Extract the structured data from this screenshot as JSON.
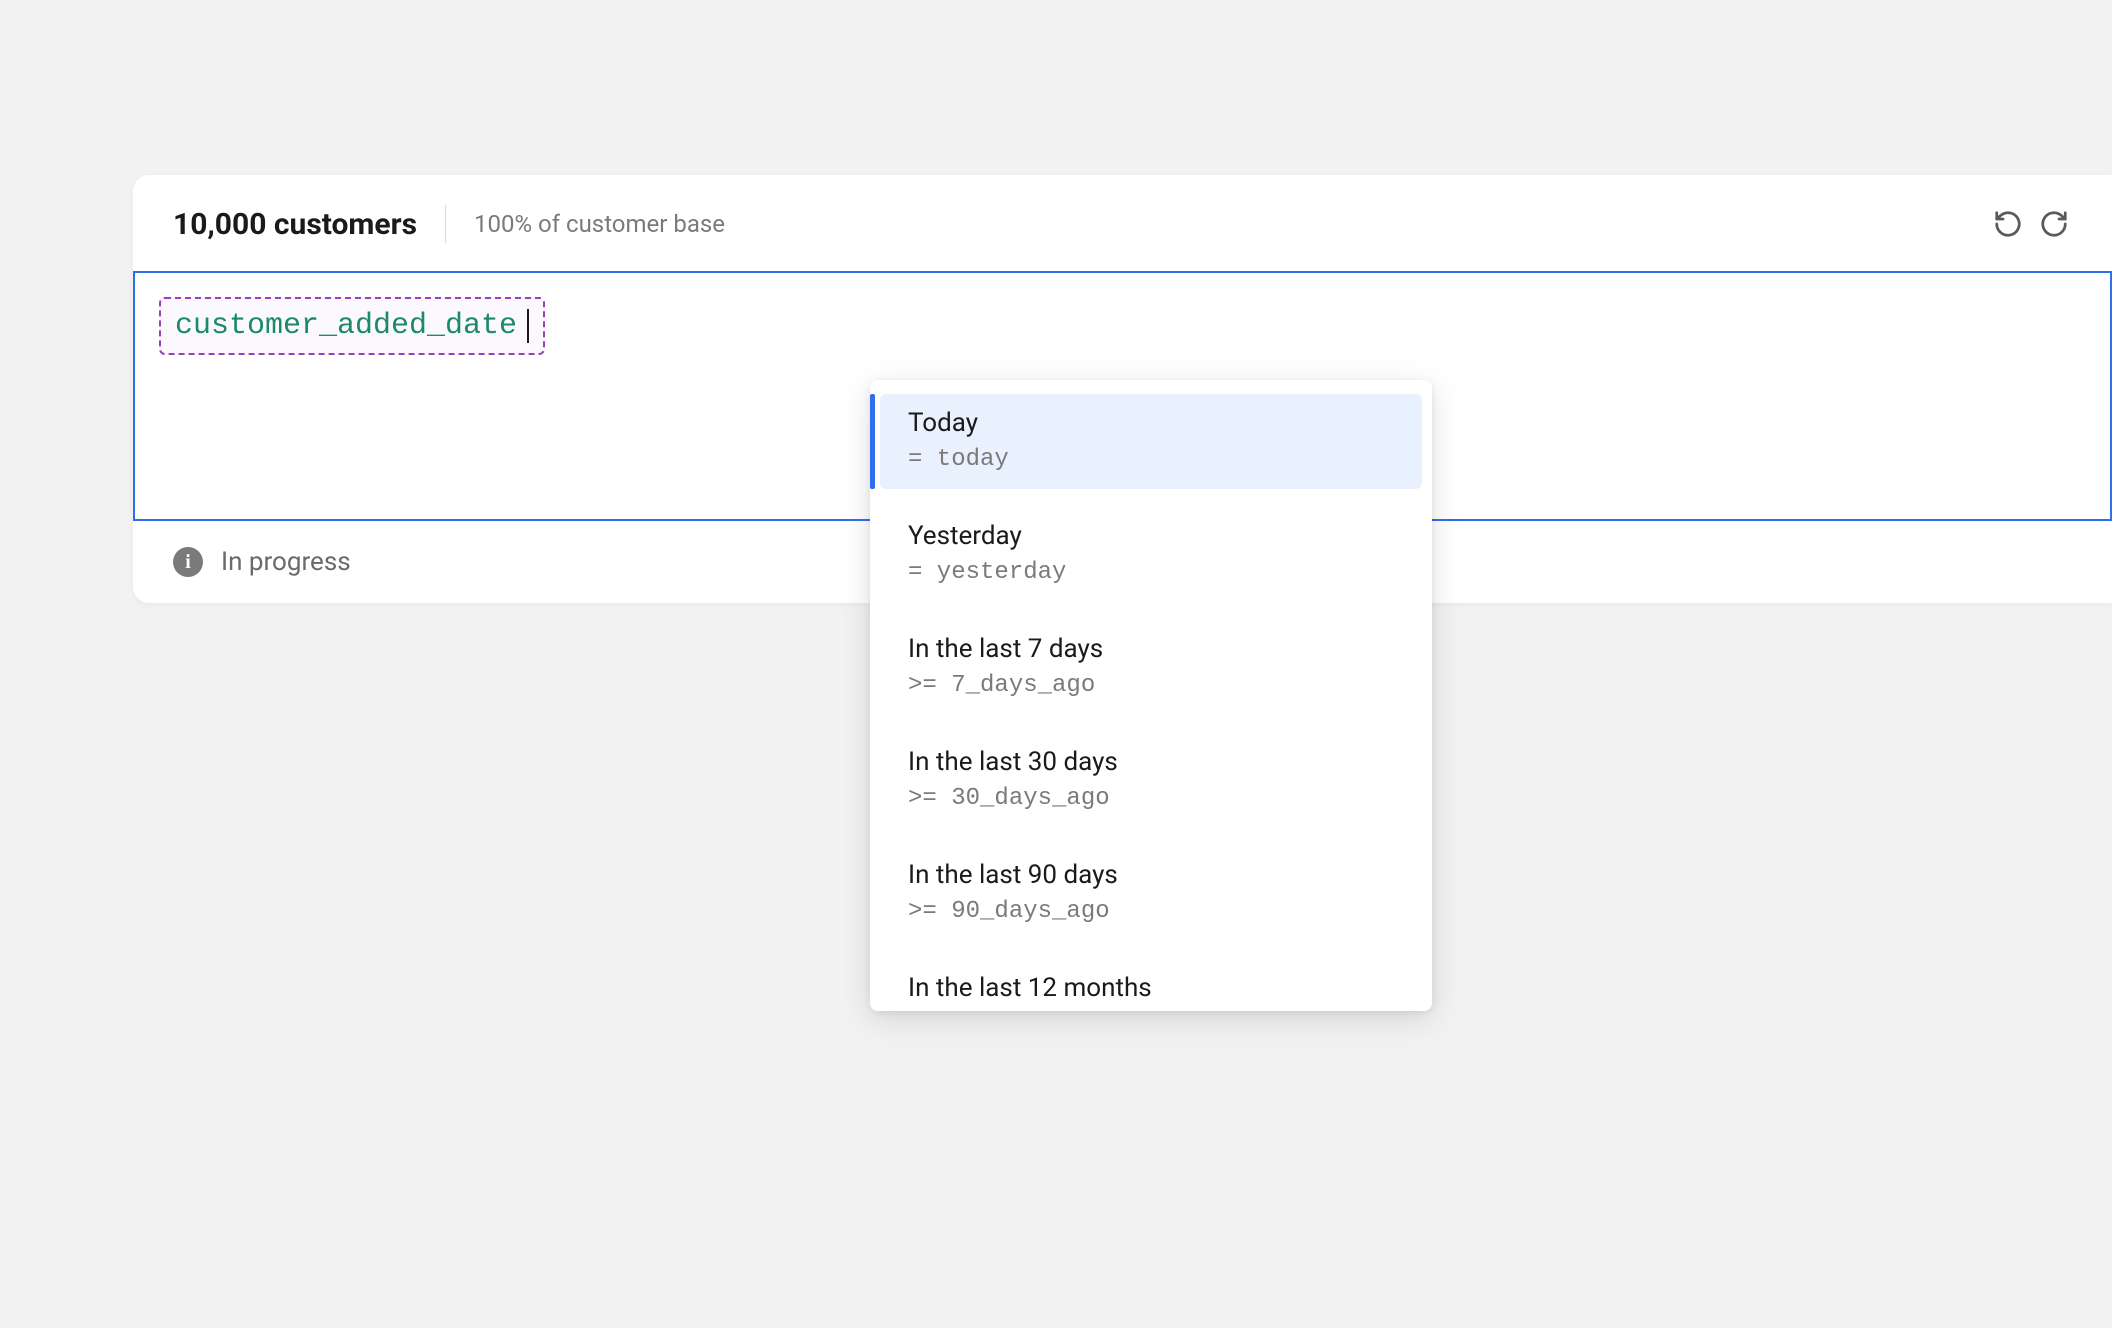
{
  "header": {
    "count_text": "10,000 customers",
    "percentage_text": "100% of customer base"
  },
  "query": {
    "token_value": "customer_added_date"
  },
  "status": {
    "text": "In progress"
  },
  "dropdown": {
    "items": [
      {
        "label": "Today",
        "code": "= today",
        "active": true
      },
      {
        "label": "Yesterday",
        "code": "= yesterday",
        "active": false
      },
      {
        "label": "In the last 7 days",
        "code": ">= 7_days_ago",
        "active": false
      },
      {
        "label": "In the last 30 days",
        "code": ">= 30_days_ago",
        "active": false
      },
      {
        "label": "In the last 90 days",
        "code": ">= 90_days_ago",
        "active": false
      },
      {
        "label": "In the last 12 months",
        "code": "",
        "active": false
      }
    ]
  }
}
